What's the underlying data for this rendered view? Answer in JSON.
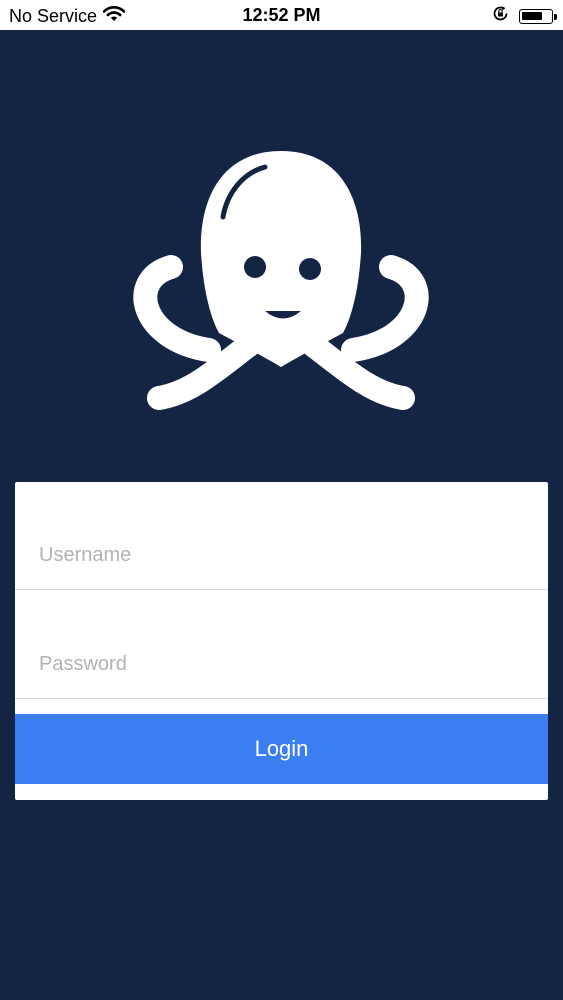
{
  "status_bar": {
    "carrier": "No Service",
    "time": "12:52 PM",
    "battery_level": 0.75,
    "icons": [
      "wifi-icon",
      "orientation-lock-icon",
      "battery-icon"
    ]
  },
  "logo": {
    "icon": "octopus-logo-icon",
    "color": "#ffffff"
  },
  "form": {
    "username_placeholder": "Username",
    "password_placeholder": "Password",
    "login_label": "Login"
  },
  "colors": {
    "background": "#142443",
    "accent": "#3b7ef1",
    "card": "#ffffff"
  }
}
